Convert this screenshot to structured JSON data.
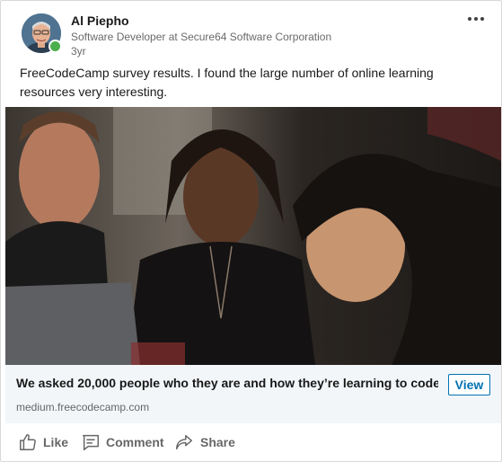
{
  "post": {
    "author": {
      "name": "Al Piepho",
      "headline": "Software Developer at Secure64 Software Corporation",
      "time": "3yr",
      "online": true
    },
    "text": "FreeCodeCamp survey results. I found the large number of online learning resources very interesting.",
    "image": {
      "icon": "photo-of-people-at-laptop"
    },
    "link_preview": {
      "title": "We asked 20,000 people who they are and how they’re learning to code",
      "domain": "medium.freecodecamp.com",
      "button_label": "View"
    },
    "actions": [
      {
        "label": "Like",
        "icon": "thumbs-up-icon"
      },
      {
        "label": "Comment",
        "icon": "comment-icon"
      },
      {
        "label": "Share",
        "icon": "share-icon"
      }
    ]
  },
  "colors": {
    "accent": "#0073b1",
    "presence": "#4cae4c",
    "preview_bg": "#f3f6f8"
  }
}
